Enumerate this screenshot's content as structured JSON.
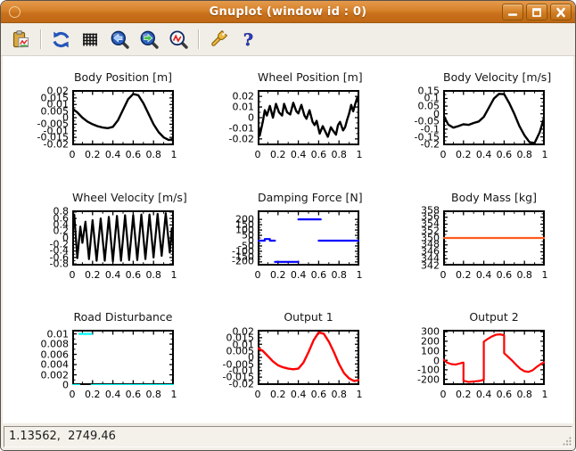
{
  "window": {
    "title": "Gnuplot (window id : 0)",
    "titlebar_color": "#d6812a",
    "controls": [
      "minimize",
      "maximize",
      "close"
    ]
  },
  "toolbar": {
    "buttons": [
      "copy-to-clipboard",
      "replot",
      "toggle-grid",
      "zoom-previous",
      "zoom-next",
      "autoscale",
      "settings",
      "help"
    ]
  },
  "statusbar": {
    "coordinates": "1.13562,  2749.46"
  },
  "chart_data": [
    {
      "type": "line",
      "title": "Body Position [m]",
      "color": "#000000",
      "linewidth": 2.4,
      "xlim": [
        0,
        1
      ],
      "ylim": [
        -0.021,
        0.021
      ],
      "xtick_labels": [
        "0",
        "0.2",
        "0.4",
        "0.6",
        "0.8",
        "1"
      ],
      "xtick_values": [
        0,
        0.2,
        0.4,
        0.6,
        0.8,
        1
      ],
      "ytick_labels": [
        "0.02",
        "0.015",
        "0.01",
        "0.005",
        "0",
        "-0.005",
        "-0.01",
        "-0.015",
        "-0.02"
      ],
      "ytick_values": [
        0.02,
        0.015,
        0.01,
        0.005,
        0,
        -0.005,
        -0.01,
        -0.015,
        -0.02
      ],
      "x": [
        0,
        0.05,
        0.1,
        0.15,
        0.2,
        0.25,
        0.3,
        0.35,
        0.4,
        0.45,
        0.5,
        0.55,
        0.6,
        0.65,
        0.7,
        0.75,
        0.8,
        0.85,
        0.9,
        0.95,
        1
      ],
      "y": [
        0.007,
        0.004,
        0,
        -0.003,
        -0.005,
        -0.0065,
        -0.0075,
        -0.008,
        -0.007,
        -0.002,
        0.006,
        0.014,
        0.018,
        0.017,
        0.011,
        0.003,
        -0.005,
        -0.011,
        -0.015,
        -0.017,
        -0.016
      ]
    },
    {
      "type": "line",
      "title": "Wheel Position [m]",
      "color": "#000000",
      "linewidth": 2.4,
      "xlim": [
        0,
        1
      ],
      "ylim": [
        -0.026,
        0.026
      ],
      "xtick_labels": [
        "0",
        "0.2",
        "0.4",
        "0.6",
        "0.8",
        "1"
      ],
      "xtick_values": [
        0,
        0.2,
        0.4,
        0.6,
        0.8,
        1
      ],
      "ytick_labels": [
        "0.02",
        "0.01",
        "0",
        "-0.01",
        "-0.02"
      ],
      "ytick_values": [
        0.02,
        0.01,
        0,
        -0.01,
        -0.02
      ],
      "x": [
        0,
        0.02,
        0.05,
        0.07,
        0.09,
        0.12,
        0.15,
        0.18,
        0.21,
        0.24,
        0.26,
        0.29,
        0.32,
        0.35,
        0.38,
        0.4,
        0.43,
        0.46,
        0.48,
        0.51,
        0.54,
        0.56,
        0.58,
        0.61,
        0.64,
        0.66,
        0.69,
        0.72,
        0.74,
        0.77,
        0.79,
        0.81,
        0.84,
        0.86,
        0.88,
        0.9,
        0.92,
        0.94,
        0.96,
        0.98,
        1
      ],
      "y": [
        -0.002,
        -0.017,
        -0.004,
        0.007,
        0.002,
        0.011,
        0,
        0.013,
        0.005,
        0.002,
        0.013,
        0.005,
        0.003,
        0.014,
        0.006,
        0.004,
        0.012,
        0.002,
        -0.001,
        0.007,
        -0.004,
        -0.007,
        -0.003,
        -0.015,
        -0.008,
        -0.012,
        -0.018,
        -0.009,
        -0.012,
        -0.016,
        -0.007,
        -0.004,
        -0.012,
        -0.009,
        -0.002,
        0.004,
        0.012,
        0.006,
        0.013,
        0.019,
        0.011
      ]
    },
    {
      "type": "line",
      "title": "Body Velocity [m/s]",
      "color": "#000000",
      "linewidth": 2.4,
      "xlim": [
        0,
        1
      ],
      "ylim": [
        -0.205,
        0.155
      ],
      "xtick_labels": [
        "0",
        "0.2",
        "0.4",
        "0.6",
        "0.8",
        "1"
      ],
      "xtick_values": [
        0,
        0.2,
        0.4,
        0.6,
        0.8,
        1
      ],
      "ytick_labels": [
        "0.15",
        "0.1",
        "0.05",
        "0",
        "-0.05",
        "-0.1",
        "-0.15",
        "-0.2"
      ],
      "ytick_values": [
        0.15,
        0.1,
        0.05,
        0,
        -0.05,
        -0.1,
        -0.15,
        -0.2
      ],
      "x": [
        0,
        0.05,
        0.1,
        0.15,
        0.2,
        0.25,
        0.3,
        0.35,
        0.4,
        0.45,
        0.5,
        0.55,
        0.6,
        0.65,
        0.7,
        0.75,
        0.8,
        0.85,
        0.9,
        0.95,
        1
      ],
      "y": [
        -0.005,
        -0.07,
        -0.09,
        -0.08,
        -0.068,
        -0.072,
        -0.06,
        -0.05,
        -0.02,
        0.04,
        0.1,
        0.13,
        0.128,
        0.07,
        0,
        -0.08,
        -0.14,
        -0.185,
        -0.19,
        -0.12,
        -0.01
      ]
    },
    {
      "type": "line",
      "title": "Wheel Velocity [m/s]",
      "color": "#000000",
      "linewidth": 2.2,
      "xlim": [
        0,
        1
      ],
      "ylim": [
        -0.85,
        0.85
      ],
      "xtick_labels": [
        "0",
        "0.2",
        "0.4",
        "0.6",
        "0.8",
        "1"
      ],
      "xtick_values": [
        0,
        0.2,
        0.4,
        0.6,
        0.8,
        1
      ],
      "ytick_labels": [
        "0.8",
        "0.6",
        "0.4",
        "0.2",
        "0",
        "-0.2",
        "-0.4",
        "-0.6",
        "-0.8"
      ],
      "ytick_values": [
        0.8,
        0.6,
        0.4,
        0.2,
        0,
        -0.2,
        -0.4,
        -0.6,
        -0.8
      ],
      "x": [
        0,
        0.02,
        0.05,
        0.08,
        0.1,
        0.13,
        0.165,
        0.2,
        0.24,
        0.28,
        0.32,
        0.36,
        0.4,
        0.44,
        0.48,
        0.52,
        0.56,
        0.6,
        0.64,
        0.68,
        0.72,
        0.76,
        0.8,
        0.84,
        0.88,
        0.92,
        0.96,
        0.98,
        1
      ],
      "y": [
        0.05,
        0.72,
        -0.62,
        0.35,
        -0.15,
        0.5,
        -0.65,
        0.55,
        -0.7,
        0.6,
        -0.7,
        0.65,
        -0.72,
        0.68,
        -0.7,
        0.7,
        -0.68,
        0.7,
        -0.68,
        0.72,
        -0.65,
        0.72,
        -0.6,
        0.74,
        -0.55,
        0.76,
        -0.45,
        0.3,
        -0.55
      ]
    },
    {
      "type": "line",
      "title": "Damping Force [N]",
      "color": "#0000ff",
      "linewidth": 2.2,
      "xlim": [
        0,
        1
      ],
      "ylim": [
        -235,
        285
      ],
      "xtick_labels": [
        "0",
        "0.2",
        "0.4",
        "0.6",
        "0.8",
        "1"
      ],
      "xtick_values": [
        0,
        0.2,
        0.4,
        0.6,
        0.8,
        1
      ],
      "ytick_labels": [
        "200",
        "150",
        "100",
        "50",
        "0",
        "-50",
        "-100",
        "-150",
        "-200"
      ],
      "ytick_values": [
        200,
        150,
        100,
        50,
        0,
        -50,
        -100,
        -150,
        -200
      ],
      "segments": [
        {
          "x": [
            0,
            0.07
          ],
          "y": [
            0,
            0
          ]
        },
        {
          "x": [
            0.07,
            0.12
          ],
          "y": [
            15,
            15
          ]
        },
        {
          "x": [
            0.12,
            0.17
          ],
          "y": [
            0,
            0
          ]
        },
        {
          "x": [
            0.17,
            0.4
          ],
          "y": [
            -200,
            -200
          ]
        },
        {
          "x": [
            0.4,
            0.62
          ],
          "y": [
            200,
            200
          ]
        },
        {
          "x": [
            0.6,
            1
          ],
          "y": [
            0,
            0
          ]
        }
      ]
    },
    {
      "type": "line",
      "title": "Body Mass [kg]",
      "color": "#ff5a1e",
      "linewidth": 2.2,
      "xlim": [
        0,
        1
      ],
      "ylim": [
        342,
        358
      ],
      "xtick_labels": [
        "0",
        "0.2",
        "0.4",
        "0.6",
        "0.8",
        "1"
      ],
      "xtick_values": [
        0,
        0.2,
        0.4,
        0.6,
        0.8,
        1
      ],
      "ytick_labels": [
        "358",
        "356",
        "354",
        "352",
        "350",
        "348",
        "346",
        "344",
        "342"
      ],
      "ytick_values": [
        358,
        356,
        354,
        352,
        350,
        348,
        346,
        344,
        342
      ],
      "x": [
        0,
        1
      ],
      "y": [
        350,
        350
      ]
    },
    {
      "type": "line",
      "title": "Road Disturbance",
      "color": "#00ffff",
      "linewidth": 2.2,
      "xlim": [
        0,
        1
      ],
      "ylim": [
        0,
        0.0108
      ],
      "xtick_labels": [
        "0",
        "0.2",
        "0.4",
        "0.6",
        "0.8",
        "1"
      ],
      "xtick_values": [
        0,
        0.2,
        0.4,
        0.6,
        0.8,
        1
      ],
      "ytick_labels": [
        "0.01",
        "0.008",
        "0.006",
        "0.004",
        "0.002",
        "0"
      ],
      "ytick_values": [
        0.01,
        0.008,
        0.006,
        0.004,
        0.002,
        0
      ],
      "segments": [
        {
          "x": [
            0,
            0.07
          ],
          "y": [
            0,
            0
          ]
        },
        {
          "x": [
            0.07,
            0.19
          ],
          "y": [
            0.01,
            0.01
          ]
        },
        {
          "x": [
            0.19,
            1
          ],
          "y": [
            0,
            0
          ]
        }
      ]
    },
    {
      "type": "line",
      "title": "Output 1",
      "color": "#ff0000",
      "linewidth": 2.4,
      "xlim": [
        0,
        1
      ],
      "ylim": [
        -0.021,
        0.021
      ],
      "xtick_labels": [
        "0",
        "0.2",
        "0.4",
        "0.6",
        "0.8",
        "1"
      ],
      "xtick_values": [
        0,
        0.2,
        0.4,
        0.6,
        0.8,
        1
      ],
      "ytick_labels": [
        "0.02",
        "0.015",
        "0.01",
        "0.005",
        "0",
        "-0.005",
        "-0.01",
        "-0.015",
        "-0.02"
      ],
      "ytick_values": [
        0.02,
        0.015,
        0.01,
        0.005,
        0,
        -0.005,
        -0.01,
        -0.015,
        -0.02
      ],
      "x": [
        0,
        0.05,
        0.1,
        0.15,
        0.2,
        0.25,
        0.3,
        0.35,
        0.4,
        0.45,
        0.5,
        0.55,
        0.6,
        0.65,
        0.7,
        0.75,
        0.8,
        0.85,
        0.9,
        0.95,
        1
      ],
      "y": [
        0.007,
        0.005,
        0.001,
        -0.003,
        -0.006,
        -0.0075,
        -0.0085,
        -0.009,
        -0.0085,
        -0.004,
        0.004,
        0.013,
        0.019,
        0.018,
        0.012,
        0.004,
        -0.005,
        -0.012,
        -0.016,
        -0.018,
        -0.017
      ]
    },
    {
      "type": "line",
      "title": "Output 2",
      "color": "#ff0000",
      "linewidth": 2.2,
      "xlim": [
        0,
        1
      ],
      "ylim": [
        -260,
        320
      ],
      "xtick_labels": [
        "0",
        "0.2",
        "0.4",
        "0.6",
        "0.8",
        "1"
      ],
      "xtick_values": [
        0,
        0.2,
        0.4,
        0.6,
        0.8,
        1
      ],
      "ytick_labels": [
        "300",
        "200",
        "100",
        "0",
        "-100",
        "-200"
      ],
      "ytick_values": [
        300,
        200,
        100,
        0,
        -100,
        -200
      ],
      "x": [
        0,
        0.04,
        0.08,
        0.12,
        0.16,
        0.19,
        0.2,
        0.2,
        0.25,
        0.3,
        0.35,
        0.4,
        0.4,
        0.44,
        0.48,
        0.52,
        0.56,
        0.6,
        0.6,
        0.64,
        0.68,
        0.72,
        0.76,
        0.8,
        0.84,
        0.88,
        0.92,
        0.96,
        1
      ],
      "y": [
        10,
        -25,
        -40,
        -45,
        -35,
        -25,
        -25,
        -215,
        -228,
        -222,
        -218,
        -205,
        195,
        225,
        250,
        268,
        272,
        262,
        75,
        35,
        -5,
        -50,
        -90,
        -115,
        -122,
        -105,
        -70,
        -40,
        -18
      ]
    }
  ]
}
